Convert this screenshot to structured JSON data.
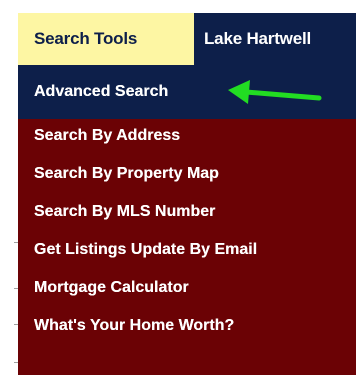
{
  "navbar": {
    "tabs": [
      {
        "label": "Search Tools"
      },
      {
        "label": "Lake Hartwell"
      }
    ]
  },
  "dropdown": {
    "items": [
      {
        "label": "Advanced Search"
      },
      {
        "label": "Search By Address"
      },
      {
        "label": "Search By Property Map"
      },
      {
        "label": "Search By MLS Number"
      },
      {
        "label": "Get Listings Update By Email"
      },
      {
        "label": "Mortgage Calculator"
      },
      {
        "label": "What's Your Home Worth?"
      }
    ]
  },
  "colors": {
    "navbar_bg": "#0d1f4a",
    "active_tab_bg": "#fdf6a3",
    "menu_bg": "#6b0205",
    "arrow": "#22dd22"
  },
  "icons": {
    "arrow": "left-arrow-icon"
  }
}
